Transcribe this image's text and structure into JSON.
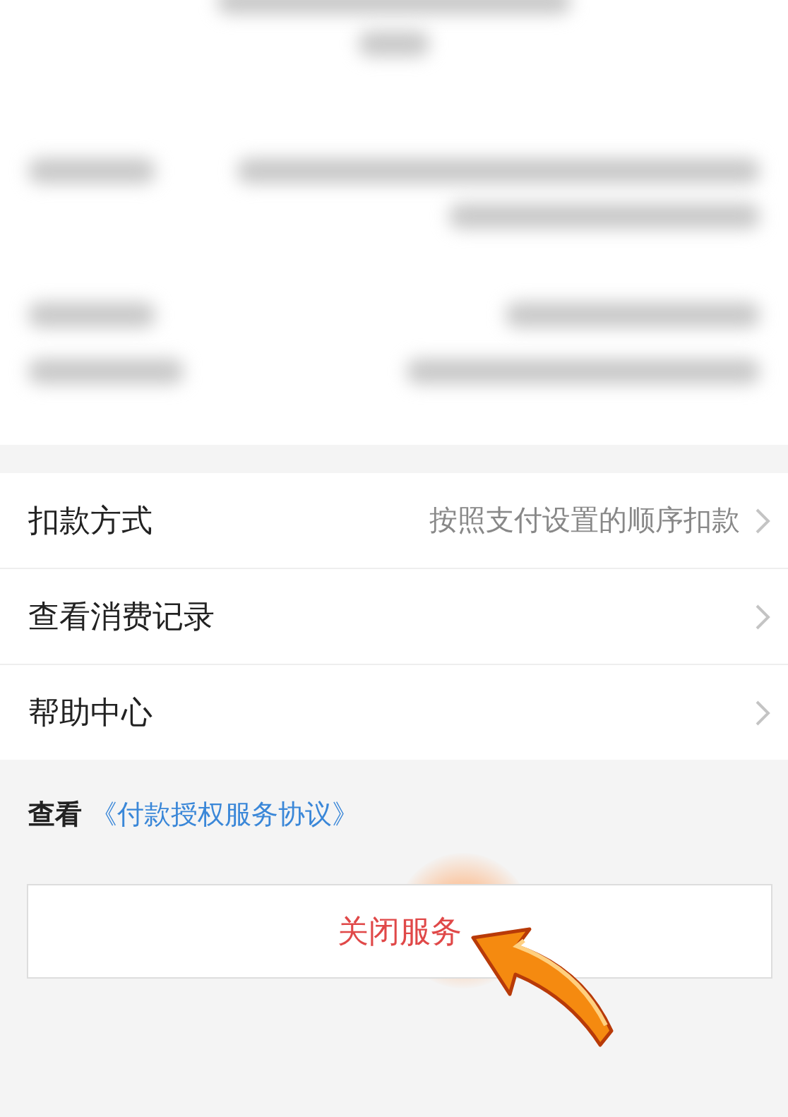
{
  "settings_rows": [
    {
      "label": "扣款方式",
      "value": "按照支付设置的顺序扣款"
    },
    {
      "label": "查看消费记录"
    },
    {
      "label": "帮助中心"
    }
  ],
  "agreement": {
    "prefix": "查看",
    "link": "《付款授权服务协议》"
  },
  "close_button": {
    "label": "关闭服务"
  }
}
